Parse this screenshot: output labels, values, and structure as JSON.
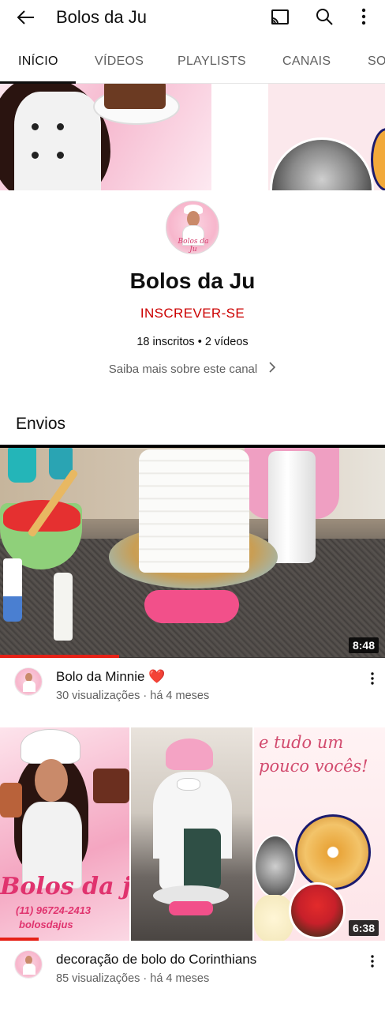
{
  "appbar": {
    "title": "Bolos da Ju"
  },
  "tabs": [
    {
      "label": "INÍCIO",
      "active": true
    },
    {
      "label": "VÍDEOS",
      "active": false
    },
    {
      "label": "PLAYLISTS",
      "active": false
    },
    {
      "label": "CANAIS",
      "active": false
    },
    {
      "label": "SO",
      "active": false
    }
  ],
  "channel": {
    "avatar_text": "Bolos da Ju",
    "name": "Bolos da Ju",
    "subscribe_label": "INSCREVER-SE",
    "stats": "18 inscritos • 2 vídeos",
    "about_label": "Saiba mais sobre este canal"
  },
  "section": {
    "title": "Envios"
  },
  "videos": [
    {
      "title": "Bolo da Minnie ❤️",
      "meta": "30 visualizações · há 4 meses",
      "duration": "8:48",
      "watched_fraction": 0.31
    },
    {
      "title": "decoração de bolo do Corinthians",
      "meta": "85 visualizações · há 4 meses",
      "duration": "6:38",
      "watched_fraction": 0.1,
      "thumb_brand": "Bolos da ju",
      "thumb_phone": "(11) 96724-2413",
      "thumb_insta": "bolosdajus",
      "thumb_script": "e tudo um pouco vocês!"
    }
  ],
  "colors": {
    "subscribe": "#cc0000",
    "progress": "#e62117",
    "text_secondary": "#606060"
  },
  "icons": {
    "back": "arrow-left",
    "cast": "cast",
    "search": "magnifier",
    "more": "vertical-dots"
  }
}
